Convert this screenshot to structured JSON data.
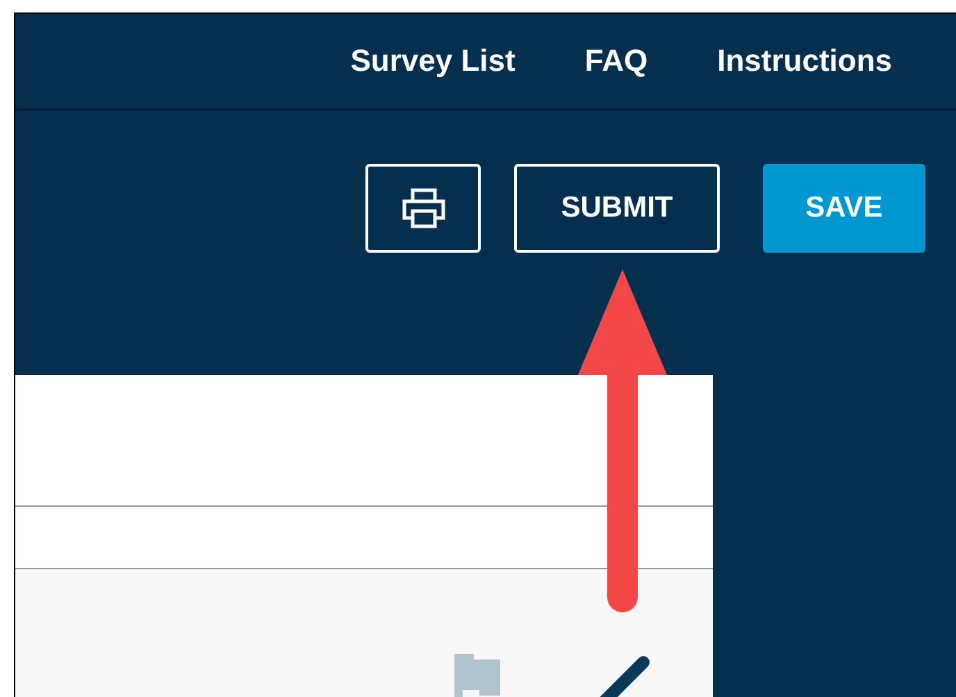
{
  "nav": {
    "items": [
      {
        "label": "Survey List"
      },
      {
        "label": "FAQ"
      },
      {
        "label": "Instructions"
      }
    ]
  },
  "actions": [
    {
      "kind": "icon"
    },
    {
      "kind": "outline",
      "label": "SUBMIT"
    },
    {
      "kind": "primary",
      "label": "SAVE"
    }
  ]
}
